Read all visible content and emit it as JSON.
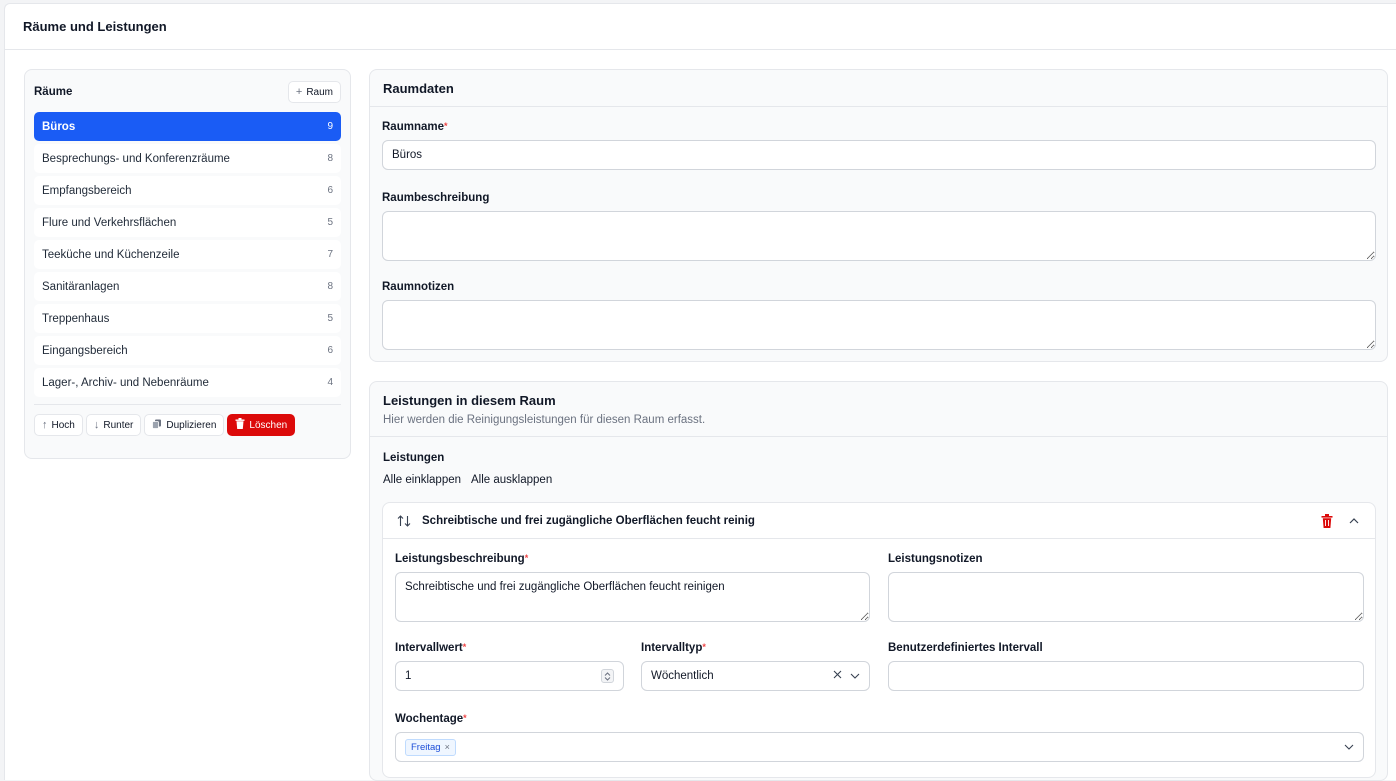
{
  "page": {
    "title": "Räume und Leistungen"
  },
  "rooms": {
    "title": "Räume",
    "add_label": "Raum",
    "items": [
      {
        "name": "Büros",
        "count": "9"
      },
      {
        "name": "Besprechungs- und Konferenzräume",
        "count": "8"
      },
      {
        "name": "Empfangsbereich",
        "count": "6"
      },
      {
        "name": "Flure und Verkehrsflächen",
        "count": "5"
      },
      {
        "name": "Teeküche und Küchenzeile",
        "count": "7"
      },
      {
        "name": "Sanitäranlagen",
        "count": "8"
      },
      {
        "name": "Treppenhaus",
        "count": "5"
      },
      {
        "name": "Eingangsbereich",
        "count": "6"
      },
      {
        "name": "Lager-, Archiv- und Nebenräume",
        "count": "4"
      }
    ],
    "actions": {
      "up": "Hoch",
      "down": "Runter",
      "duplicate": "Duplizieren",
      "delete": "Löschen"
    }
  },
  "room_data": {
    "title": "Raumdaten",
    "name_label": "Raumname",
    "name_value": "Büros",
    "description_label": "Raumbeschreibung",
    "description_value": "",
    "notes_label": "Raumnotizen",
    "notes_value": ""
  },
  "services": {
    "title": "Leistungen in diesem Raum",
    "subtitle": "Hier werden die Reinigungsleistungen für diesen Raum erfasst.",
    "section_label": "Leistungen",
    "collapse_all": "Alle einklappen",
    "expand_all": "Alle ausklappen",
    "item": {
      "header_title": "Schreibtische und frei zugängliche Oberflächen feucht reinig",
      "description_label": "Leistungsbeschreibung",
      "description_value": "Schreibtische und frei zugängliche Oberflächen feucht reinigen",
      "notes_label": "Leistungsnotizen",
      "notes_value": "",
      "interval_value_label": "Intervallwert",
      "interval_value": "1",
      "interval_type_label": "Intervalltyp",
      "interval_type_value": "Wöchentlich",
      "custom_interval_label": "Benutzerdefiniertes Intervall",
      "custom_interval_value": "",
      "weekdays_label": "Wochentage",
      "weekdays": [
        "Freitag"
      ]
    }
  },
  "colors": {
    "accent": "#1a5cf5",
    "danger": "#dc0a0a",
    "required": "#ef4444"
  }
}
